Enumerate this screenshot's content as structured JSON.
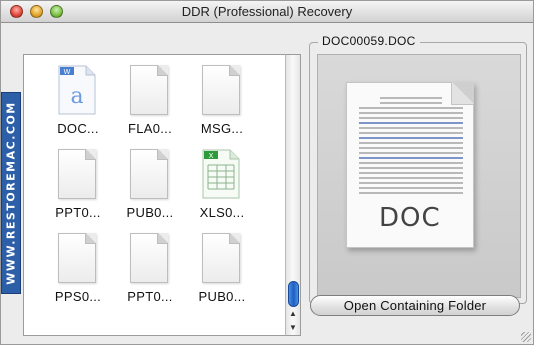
{
  "window": {
    "title": "DDR (Professional) Recovery"
  },
  "watermark": {
    "text": "WWW.RESTOREMAC.COM"
  },
  "files": [
    {
      "name": "DOC...",
      "icon": "word-document-icon",
      "type": "doc"
    },
    {
      "name": "FLA0...",
      "icon": "blank-file-icon",
      "type": "blank"
    },
    {
      "name": "MSG...",
      "icon": "blank-file-icon",
      "type": "blank"
    },
    {
      "name": "PPT0...",
      "icon": "blank-file-icon",
      "type": "blank"
    },
    {
      "name": "PUB0...",
      "icon": "blank-file-icon",
      "type": "blank"
    },
    {
      "name": "XLS0...",
      "icon": "spreadsheet-icon",
      "type": "xls"
    },
    {
      "name": "PPS0...",
      "icon": "blank-file-icon",
      "type": "blank"
    },
    {
      "name": "PPT0...",
      "icon": "blank-file-icon",
      "type": "blank"
    },
    {
      "name": "PUB0...",
      "icon": "blank-file-icon",
      "type": "blank"
    }
  ],
  "preview": {
    "filename": "DOC00059.DOC",
    "badge": "DOC"
  },
  "buttons": {
    "open_folder": "Open Containing Folder"
  },
  "colors": {
    "accent_blue": "#2d5ea8",
    "scroll_thumb": "#1f5fc4",
    "xls_green": "#2e9a3a",
    "doc_blue": "#4a7fd0"
  }
}
